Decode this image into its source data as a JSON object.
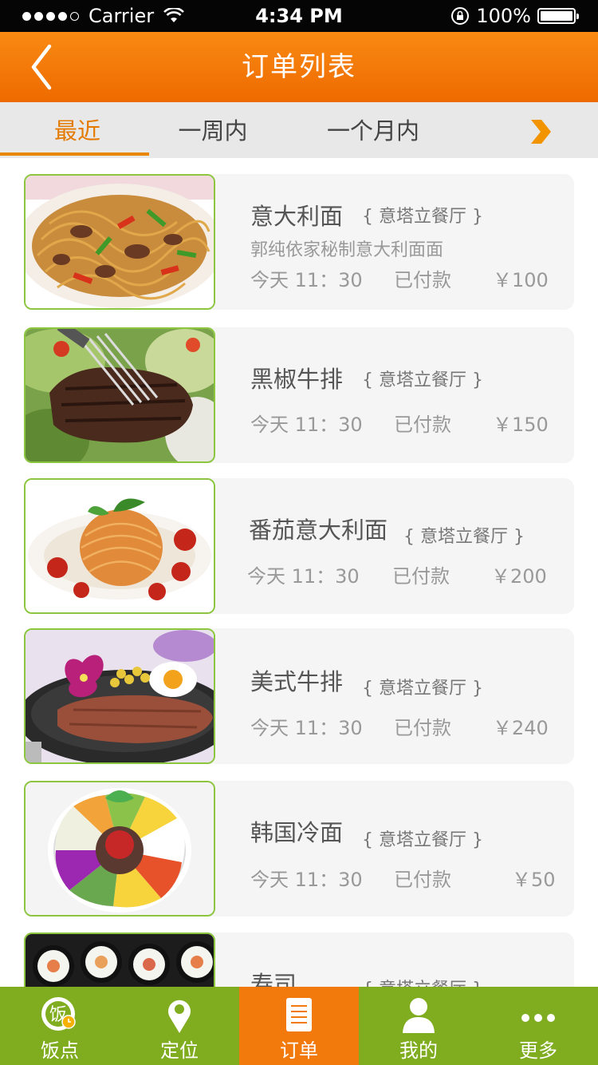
{
  "status_bar": {
    "carrier": "Carrier",
    "time": "4:34 PM",
    "battery": "100%"
  },
  "header": {
    "title": "订单列表"
  },
  "tabs": [
    {
      "label": "最近",
      "active": true
    },
    {
      "label": "一周内",
      "active": false
    },
    {
      "label": "一个月内",
      "active": false
    }
  ],
  "orders": [
    {
      "name": "意大利面",
      "shop": "{ 意塔立餐厅 }",
      "desc": "郭纯依家秘制意大利面面",
      "time": "今天 11：30",
      "status": "已付款",
      "price": "￥100"
    },
    {
      "name": "黑椒牛排",
      "shop": "{ 意塔立餐厅 }",
      "desc": "",
      "time": "今天 11：30",
      "status": "已付款",
      "price": "￥150"
    },
    {
      "name": "番茄意大利面",
      "shop": "{ 意塔立餐厅 }",
      "desc": "",
      "time": "今天 11：30",
      "status": "已付款",
      "price": "￥200"
    },
    {
      "name": "美式牛排",
      "shop": "{ 意塔立餐厅 }",
      "desc": "",
      "time": "今天 11：30",
      "status": "已付款",
      "price": "￥240"
    },
    {
      "name": "韩国冷面",
      "shop": "{ 意塔立餐厅 }",
      "desc": "",
      "time": "今天 11：30",
      "status": "已付款",
      "price": "￥50"
    },
    {
      "name": "寿司",
      "shop": "{ 意塔立餐厅 }",
      "desc": "",
      "time": "",
      "status": "",
      "price": ""
    }
  ],
  "tabbar": [
    {
      "label": "饭点",
      "icon": "rice-clock-icon",
      "active": false
    },
    {
      "label": "定位",
      "icon": "location-pin-icon",
      "active": false
    },
    {
      "label": "订单",
      "icon": "order-list-icon",
      "active": true
    },
    {
      "label": "我的",
      "icon": "user-icon",
      "active": false
    },
    {
      "label": "更多",
      "icon": "more-dots-icon",
      "active": false
    }
  ],
  "colors": {
    "brand_orange": "#f27a0d",
    "tabbar_green": "#7fad1f",
    "thumb_border_green": "#8cc63f",
    "active_tab_orange": "#e57a00"
  }
}
